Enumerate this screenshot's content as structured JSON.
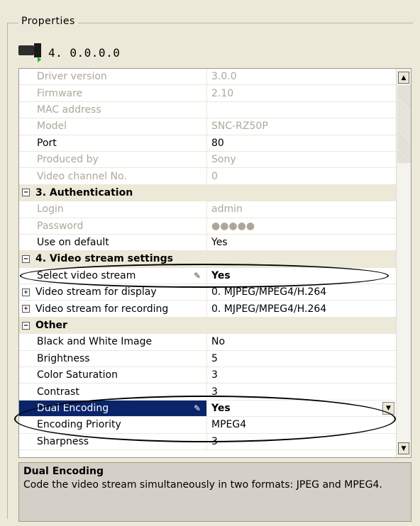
{
  "panel": {
    "title": "Properties"
  },
  "camera": {
    "label": "4. 0.0.0.0",
    "icon": "camera-icon"
  },
  "rows": [
    {
      "name": "Driver version",
      "value": "3.0.0",
      "type": "disabled"
    },
    {
      "name": "Firmware",
      "value": "2.10",
      "type": "disabled"
    },
    {
      "name": "MAC address",
      "value": "",
      "type": "disabled"
    },
    {
      "name": "Model",
      "value": "SNC-RZ50P",
      "type": "disabled"
    },
    {
      "name": "Port",
      "value": "80",
      "type": "normal"
    },
    {
      "name": "Produced by",
      "value": "Sony",
      "type": "disabled"
    },
    {
      "name": "Video channel No.",
      "value": "0",
      "type": "disabled"
    },
    {
      "name": "3. Authentication",
      "value": "",
      "type": "section"
    },
    {
      "name": "Login",
      "value": "admin",
      "type": "disabled"
    },
    {
      "name": "Password",
      "value": "●●●●●",
      "type": "disabled"
    },
    {
      "name": "Use on default",
      "value": "Yes",
      "type": "normal"
    },
    {
      "name": "4. Video stream settings",
      "value": "",
      "type": "section"
    },
    {
      "name": "Select video stream",
      "value": "Yes",
      "type": "bold-edit"
    },
    {
      "name": "Video stream for display",
      "value": "0. MJPEG/MPEG4/H.264",
      "type": "expandable"
    },
    {
      "name": "Video stream for recording",
      "value": "0. MJPEG/MPEG4/H.264",
      "type": "expandable"
    },
    {
      "name": "Other",
      "value": "",
      "type": "section"
    },
    {
      "name": "Black and White Image",
      "value": "No",
      "type": "normal"
    },
    {
      "name": "Brightness",
      "value": "5",
      "type": "normal"
    },
    {
      "name": "Color Saturation",
      "value": "3",
      "type": "normal"
    },
    {
      "name": "Contrast",
      "value": "3",
      "type": "normal"
    },
    {
      "name": "Dual Encoding",
      "value": "Yes",
      "type": "selected"
    },
    {
      "name": "Encoding Priority",
      "value": "MPEG4",
      "type": "normal"
    },
    {
      "name": "Sharpness",
      "value": "3",
      "type": "normal"
    }
  ],
  "help": {
    "title": "Dual Encoding",
    "text": "Code the video stream simultaneously in two formats: JPEG and MPEG4."
  },
  "symbols": {
    "collapse": "−",
    "expand": "+",
    "pen": "✎",
    "arrow_up": "▲",
    "arrow_down": "▼"
  },
  "colors": {
    "selection": "#0a246a",
    "panel": "#ece9d8",
    "disabled_text": "#aca899"
  }
}
